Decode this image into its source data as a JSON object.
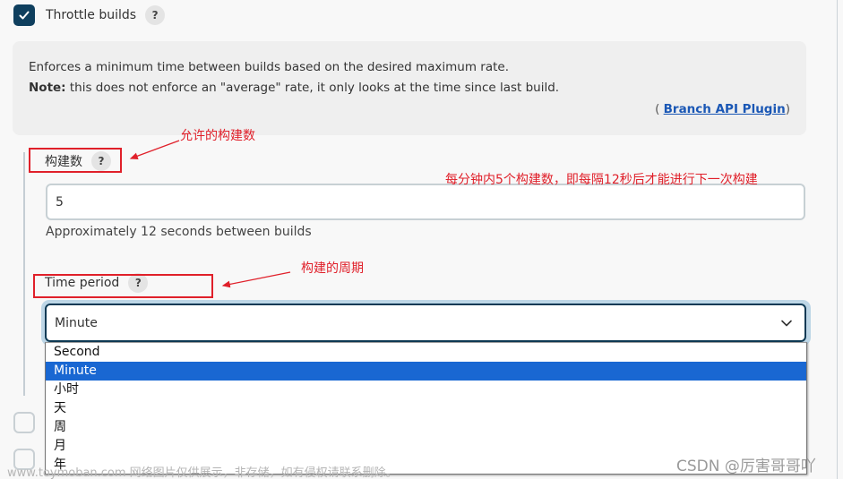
{
  "throttle": {
    "checked": true,
    "label": "Throttle builds",
    "help_label": "?"
  },
  "help_box": {
    "line1": "Enforces a minimum time between builds based on the desired maximum rate.",
    "note_label": "Note:",
    "line2_rest": " this does not enforce an \"average\" rate, it only looks at the time since last build.",
    "plugin_prefix": "( ",
    "plugin_link": "Branch API Plugin",
    "plugin_suffix": ")"
  },
  "count_field": {
    "label": "构建数",
    "help_label": "?",
    "value": "5",
    "hint": "Approximately 12 seconds between builds"
  },
  "period_field": {
    "label": "Time period",
    "help_label": "?",
    "selected": "Minute",
    "options": [
      "Second",
      "Minute",
      "小时",
      "天",
      "周",
      "月",
      "年"
    ]
  },
  "annotations": {
    "count_note": "允许的构建数",
    "rate_note": "每分钟内5个构建数，即每隔12秒后才能进行下一次构建",
    "period_note": "构建的周期",
    "color": "#e0202a"
  },
  "watermarks": {
    "site": "www.toymoban.com 网络图片仅供展示，非存储，如有侵权请联系删除。",
    "author": "CSDN @厉害哥哥吖"
  },
  "colors": {
    "checkbox_fill": "#0f3f5e",
    "selected_option": "#1967d2",
    "link": "#1a57b5"
  }
}
